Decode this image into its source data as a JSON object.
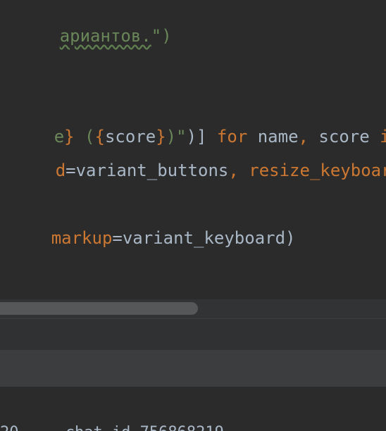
{
  "editor": {
    "line1": {
      "string_part": "ариантов.",
      "tail": "\")"
    },
    "line2": {
      "brace_close": "}",
      "space_paren": " (",
      "brace_open2": "{",
      "var_score": "score",
      "brace_close2": "}",
      "string_end": ")\"",
      "close": ")]",
      "kw_for": " for",
      "names": " name",
      "comma": ",",
      "score2": " score",
      "kw_in": " in"
    },
    "line3": {
      "param_frag": "d",
      "equals_value": "=variant_buttons",
      "comma": ",",
      "param_resize": " resize_keyboard",
      "equals": "="
    },
    "line4": {
      "param_markup": "markup",
      "equals_value": "=variant_keyboard)"
    }
  },
  "console": {
    "partial_line": "20 ... chat_id 756868219"
  },
  "colors": {
    "editor_bg": "#2b2b2b",
    "text": "#a9b7c6",
    "string": "#6a8759",
    "keyword": "#cc7832",
    "scroll_thumb": "#555759"
  }
}
